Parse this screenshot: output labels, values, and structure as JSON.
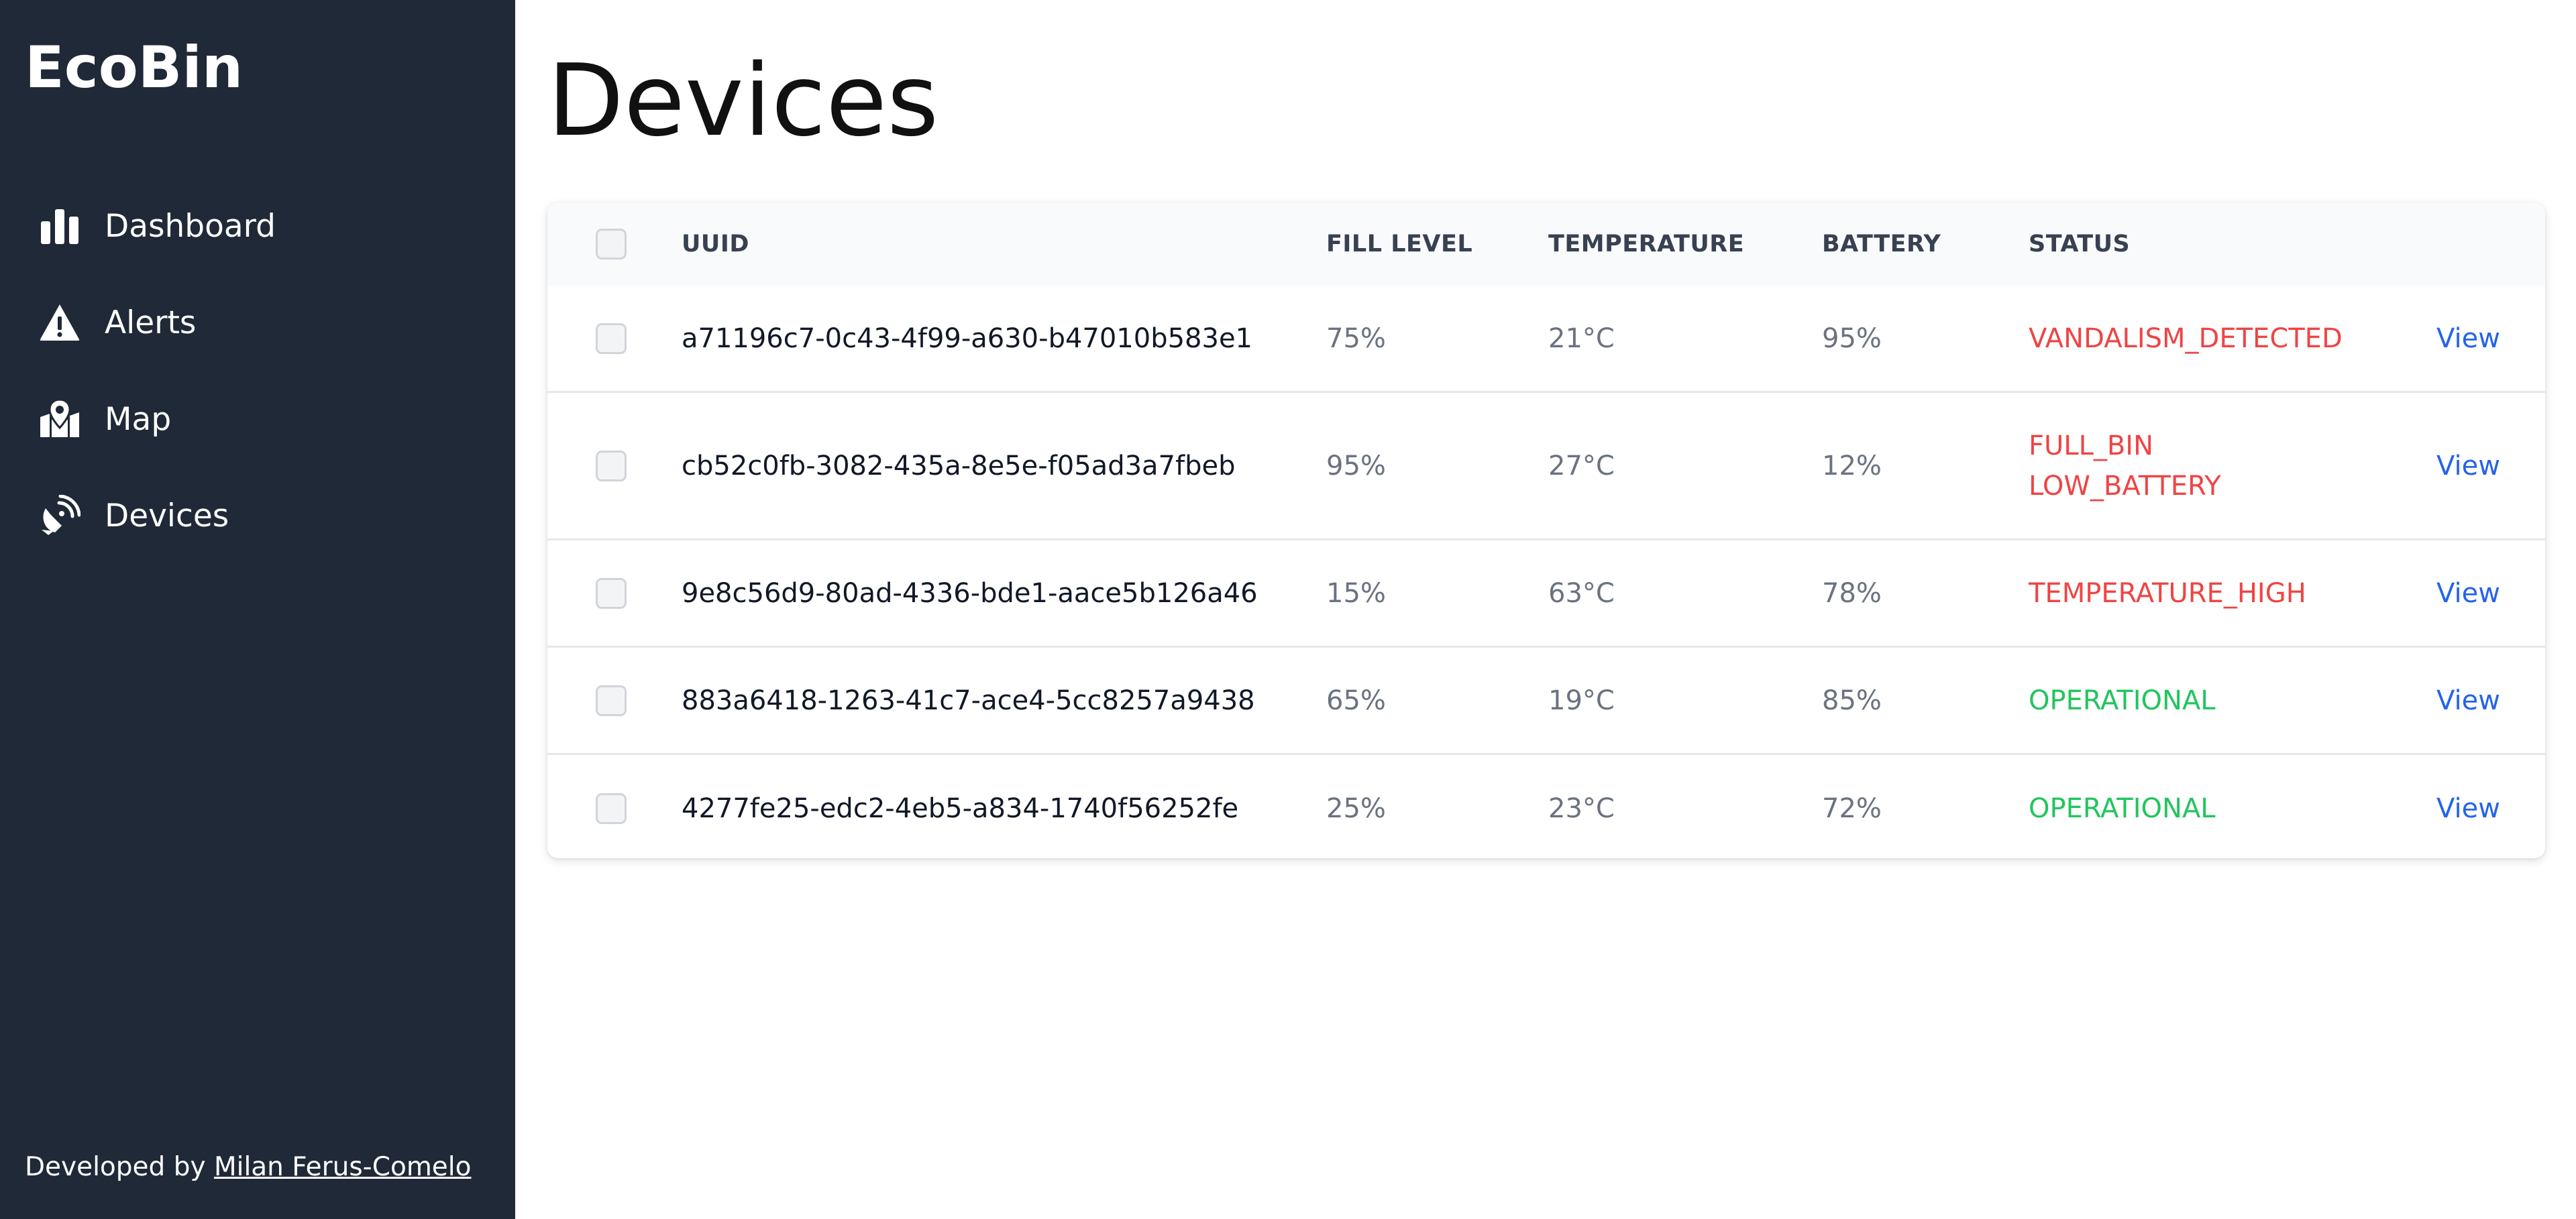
{
  "app": {
    "brand": "EcoBin"
  },
  "sidebar": {
    "items": [
      {
        "label": "Dashboard",
        "icon": "bar-chart-icon"
      },
      {
        "label": "Alerts",
        "icon": "warning-icon"
      },
      {
        "label": "Map",
        "icon": "map-pin-icon"
      },
      {
        "label": "Devices",
        "icon": "satellite-dish-icon"
      }
    ],
    "footer": {
      "prefix": "Developed by",
      "author": "Milan Ferus-Comelo"
    }
  },
  "main": {
    "title": "Devices",
    "table": {
      "headers": {
        "uuid": "UUID",
        "fill": "FILL LEVEL",
        "temperature": "TEMPERATURE",
        "battery": "BATTERY",
        "status": "STATUS"
      },
      "rows": [
        {
          "uuid": "a71196c7-0c43-4f99-a630-b47010b583e1",
          "fill": "75%",
          "temperature": "21°C",
          "battery": "95%",
          "status": [
            "VANDALISM_DETECTED"
          ],
          "status_kind": "alert",
          "action": "View"
        },
        {
          "uuid": "cb52c0fb-3082-435a-8e5e-f05ad3a7fbeb",
          "fill": "95%",
          "temperature": "27°C",
          "battery": "12%",
          "status": [
            "FULL_BIN",
            "LOW_BATTERY"
          ],
          "status_kind": "alert",
          "action": "View"
        },
        {
          "uuid": "9e8c56d9-80ad-4336-bde1-aace5b126a46",
          "fill": "15%",
          "temperature": "63°C",
          "battery": "78%",
          "status": [
            "TEMPERATURE_HIGH"
          ],
          "status_kind": "alert",
          "action": "View"
        },
        {
          "uuid": "883a6418-1263-41c7-ace4-5cc8257a9438",
          "fill": "65%",
          "temperature": "19°C",
          "battery": "85%",
          "status": [
            "OPERATIONAL"
          ],
          "status_kind": "ok",
          "action": "View"
        },
        {
          "uuid": "4277fe25-edc2-4eb5-a834-1740f56252fe",
          "fill": "25%",
          "temperature": "23°C",
          "battery": "72%",
          "status": [
            "OPERATIONAL"
          ],
          "status_kind": "ok",
          "action": "View"
        }
      ]
    }
  },
  "colors": {
    "sidebar_bg": "#1f2937",
    "status_alert": "#ef4444",
    "status_ok": "#22c55e",
    "link": "#2563eb"
  }
}
